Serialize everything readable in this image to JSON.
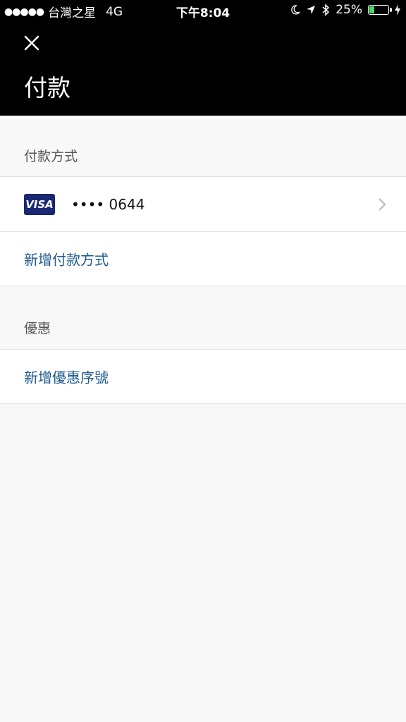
{
  "status_bar": {
    "signal": "●●●●●",
    "carrier": "台灣之星",
    "network": "4G",
    "time": "下午8:04",
    "battery_percent": "25%",
    "battery_level": 0.25
  },
  "header": {
    "title": "付款"
  },
  "payment_section": {
    "header": "付款方式",
    "card": {
      "brand": "VISA",
      "number": "•••• 0644"
    },
    "add_label": "新增付款方式"
  },
  "promo_section": {
    "header": "優惠",
    "add_label": "新增優惠序號"
  },
  "colors": {
    "header_bg": "#000000",
    "link": "#1e5a8e",
    "visa_bg": "#1a2772",
    "page_bg": "#f8f8f8"
  }
}
